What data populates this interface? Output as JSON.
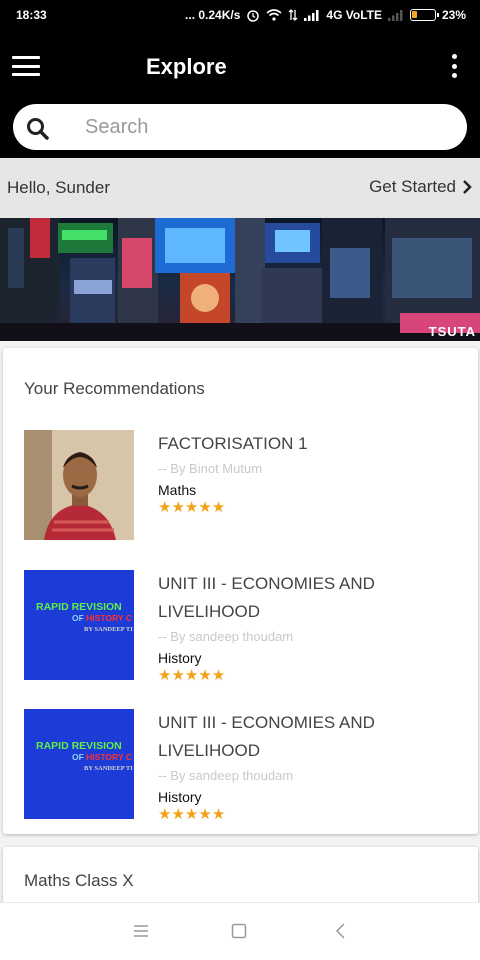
{
  "status_bar": {
    "time": "18:33",
    "speed": "... 0.24K/s",
    "network": "4G VoLTE",
    "battery": "23%",
    "battery_level": 0.23
  },
  "app_bar": {
    "title": "Explore",
    "menu_icon": "hamburger-icon",
    "more_icon": "more-vertical-icon"
  },
  "search": {
    "placeholder": "Search",
    "value": ""
  },
  "greeting": {
    "hello": "Hello, Sunder",
    "get_started": "Get Started"
  },
  "banner": {
    "tag": "TSUTA"
  },
  "recommendations": {
    "title": "Your Recommendations",
    "items": [
      {
        "title": "FACTORISATION 1",
        "author": "-- By Binot Mutum",
        "subject": "Maths",
        "rating": 5,
        "thumb_type": "photo"
      },
      {
        "title": "UNIT III - ECONOMIES AND LIVELIHOOD",
        "author": "-- By sandeep thoudam",
        "subject": "History",
        "rating": 5,
        "thumb_type": "book",
        "thumb_text": {
          "line1": "RAPID REVISION",
          "line2_a": "OF ",
          "line2_b": "HISTORY C",
          "line3": "BY SANDEEP TI"
        }
      },
      {
        "title": "UNIT III - ECONOMIES AND LIVELIHOOD",
        "author": "-- By sandeep thoudam",
        "subject": "History",
        "rating": 5,
        "thumb_type": "book",
        "thumb_text": {
          "line1": "RAPID REVISION",
          "line2_a": "OF ",
          "line2_b": "HISTORY C",
          "line3": "BY SANDEEP TI"
        }
      }
    ]
  },
  "maths_section": {
    "title": "Maths Class X"
  },
  "colors": {
    "star": "#f2a11a",
    "book_cover": "#1d3bd6",
    "greeting_bg": "#e6e6e6"
  }
}
